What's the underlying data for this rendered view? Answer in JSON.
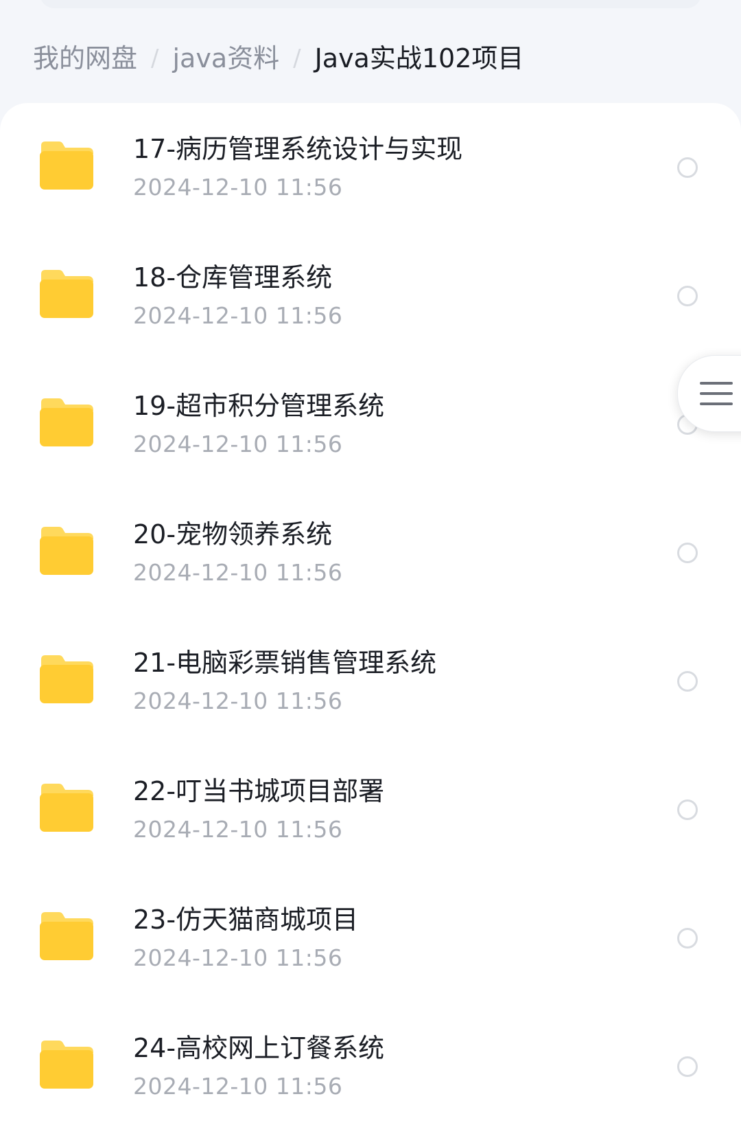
{
  "breadcrumb": [
    {
      "label": "我的网盘",
      "current": false
    },
    {
      "label": "java资料",
      "current": false
    },
    {
      "label": "Java实战102项目",
      "current": true
    }
  ],
  "breadcrumb_separator": "/",
  "files": [
    {
      "name": "17-病历管理系统设计与实现",
      "date": "2024-12-10  11:56",
      "icon": "folder-icon"
    },
    {
      "name": "18-仓库管理系统",
      "date": "2024-12-10  11:56",
      "icon": "folder-icon"
    },
    {
      "name": "19-超市积分管理系统",
      "date": "2024-12-10  11:56",
      "icon": "folder-icon"
    },
    {
      "name": "20-宠物领养系统",
      "date": "2024-12-10  11:56",
      "icon": "folder-icon"
    },
    {
      "name": "21-电脑彩票销售管理系统",
      "date": "2024-12-10  11:56",
      "icon": "folder-icon"
    },
    {
      "name": "22-叮当书城项目部署",
      "date": "2024-12-10  11:56",
      "icon": "folder-icon"
    },
    {
      "name": "23-仿天猫商城项目",
      "date": "2024-12-10  11:56",
      "icon": "folder-icon"
    },
    {
      "name": "24-高校网上订餐系统",
      "date": "2024-12-10  11:56",
      "icon": "folder-icon"
    }
  ],
  "floating_button": {
    "icon": "menu-icon"
  },
  "colors": {
    "folder": "#ffcc33",
    "folder_tab": "#ffd95c",
    "text_primary": "#1b1e25",
    "text_secondary": "#a8acb4",
    "breadcrumb_inactive": "#8a8f9b",
    "background": "#f4f6fa"
  }
}
